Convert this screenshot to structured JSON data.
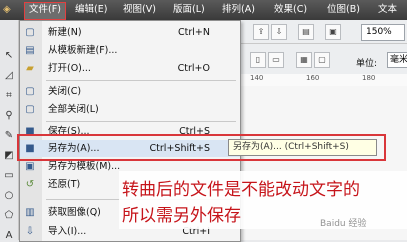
{
  "menubar": {
    "items": [
      "文件(F)",
      "编辑(E)",
      "视图(V)",
      "版面(L)",
      "排列(A)",
      "效果(C)",
      "位图(B)",
      "文本"
    ]
  },
  "toolbar": {
    "zoom": "150%",
    "unit_label": "单位:",
    "unit_value": "毫米"
  },
  "ruler": {
    "ticks": [
      "140",
      "160",
      "180"
    ]
  },
  "file_menu": {
    "items": [
      {
        "label": "新建(N)",
        "shortcut": "Ctrl+N",
        "icon": "new-document-icon"
      },
      {
        "label": "从模板新建(F)...",
        "shortcut": "",
        "icon": "template-icon"
      },
      {
        "label": "打开(O)...",
        "shortcut": "Ctrl+O",
        "icon": "open-folder-icon"
      },
      {
        "label": "关闭(C)",
        "shortcut": "",
        "icon": "close-document-icon"
      },
      {
        "label": "全部关闭(L)",
        "shortcut": "",
        "icon": "close-all-icon"
      },
      {
        "label": "保存(S)...",
        "shortcut": "Ctrl+S",
        "icon": "save-icon"
      },
      {
        "label": "另存为(A)...",
        "shortcut": "Ctrl+Shift+S",
        "icon": "save-as-icon"
      },
      {
        "label": "另存为模板(M)...",
        "shortcut": "",
        "icon": "save-as-template-icon"
      },
      {
        "label": "还原(T)",
        "shortcut": "",
        "icon": "revert-icon"
      },
      {
        "label": "获取图像(Q)",
        "shortcut": "",
        "icon": "acquire-image-icon"
      },
      {
        "label": "导入(I)...",
        "shortcut": "Ctrl+I",
        "icon": "import-icon"
      }
    ]
  },
  "tooltip": "另存为(A)... (Ctrl+Shift+S)",
  "annotation": {
    "line1": "转曲后的文件是不能改动文字的",
    "line2": "所以需另外保存"
  },
  "watermark": "Baidu 经验"
}
